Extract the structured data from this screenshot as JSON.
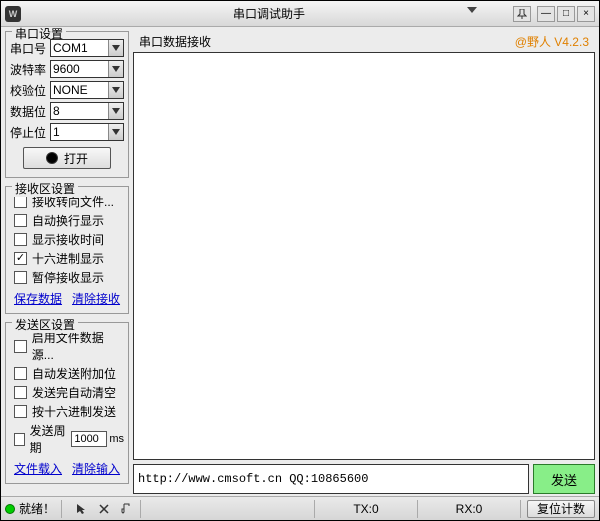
{
  "window": {
    "title": "串口调试助手",
    "icon_text": "W"
  },
  "port_group": {
    "title": "串口设置",
    "fields": {
      "port_label": "串口号",
      "port_value": "COM1",
      "baud_label": "波特率",
      "baud_value": "9600",
      "parity_label": "校验位",
      "parity_value": "NONE",
      "databits_label": "数据位",
      "databits_value": "8",
      "stopbits_label": "停止位",
      "stopbits_value": "1"
    },
    "open_label": "打开"
  },
  "recv_group": {
    "title": "接收区设置",
    "items": [
      {
        "label": "接收转向文件...",
        "checked": false
      },
      {
        "label": "自动换行显示",
        "checked": false
      },
      {
        "label": "显示接收时间",
        "checked": false
      },
      {
        "label": "十六进制显示",
        "checked": true
      },
      {
        "label": "暂停接收显示",
        "checked": false
      }
    ],
    "links": {
      "save": "保存数据",
      "clear": "清除接收"
    }
  },
  "send_group": {
    "title": "发送区设置",
    "items": [
      {
        "label": "启用文件数据源...",
        "checked": false
      },
      {
        "label": "自动发送附加位",
        "checked": false
      },
      {
        "label": "发送完自动清空",
        "checked": false
      },
      {
        "label": "按十六进制发送",
        "checked": false
      }
    ],
    "period_checked": false,
    "period_label": "发送周期",
    "period_value": "1000",
    "period_unit": "ms",
    "links": {
      "load": "文件载入",
      "clear": "清除输入"
    }
  },
  "recv_header": {
    "left": "串口数据接收",
    "right": "@野人 V4.2.3"
  },
  "send_area": {
    "text": "http://www.cmsoft.cn QQ:10865600",
    "button": "发送"
  },
  "statusbar": {
    "ready": "就绪！",
    "tx_label": "TX:0",
    "rx_label": "RX:0",
    "reset": "复位计数"
  }
}
